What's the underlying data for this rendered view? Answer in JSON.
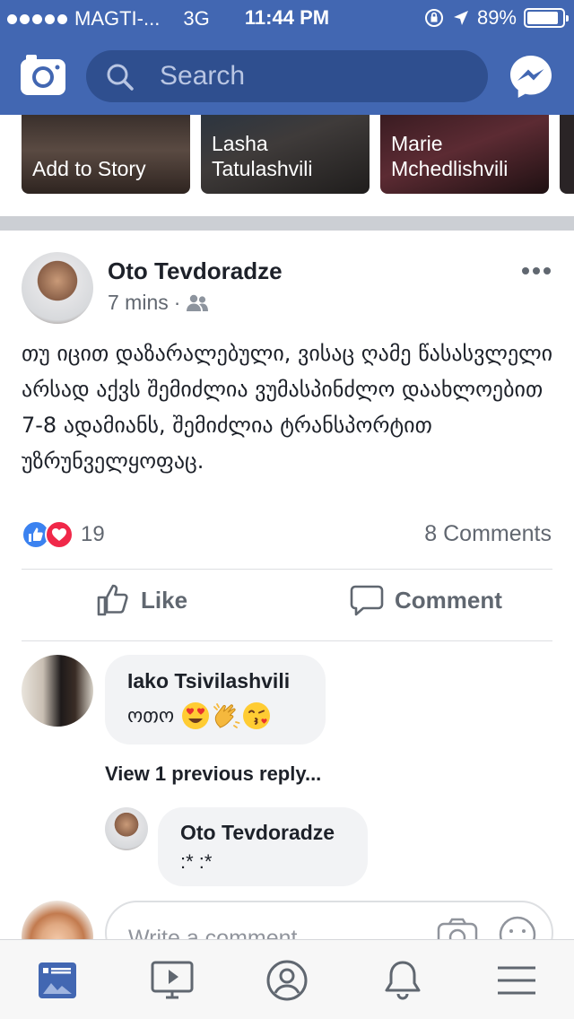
{
  "status_bar": {
    "carrier": "MAGTI-...",
    "network": "3G",
    "time": "11:44 PM",
    "battery": "89%",
    "battery_level": 0.89
  },
  "header": {
    "search_placeholder": "Search",
    "icons": [
      "camera-icon",
      "search-icon",
      "messenger-icon"
    ]
  },
  "stories": [
    {
      "label": "Add to Story"
    },
    {
      "label": "Lasha Tatulashvili"
    },
    {
      "label": "Marie Mchedlishvili"
    }
  ],
  "post": {
    "author": "Oto Tevdoradze",
    "time": "7 mins",
    "separator": "·",
    "audience_icon": "friends-icon",
    "text": "თუ იცით დაზარალებული, ვისაც ღამე წასასვლელი არსად აქვს შემიძლია ვუმასპინძლო დაახლოებით 7-8 ადამიანს, შემიძლია ტრანსპორტით უზრუნველყოფაც.",
    "reactions_count": "19",
    "reaction_types": [
      "like",
      "love"
    ],
    "comments_count": "8 Comments",
    "actions": {
      "like": "Like",
      "comment": "Comment"
    }
  },
  "comments": [
    {
      "author": "Iako Tsivilashvili",
      "text": "ოთო",
      "emojis": [
        "heart-eyes",
        "clapping-hands",
        "kissing-face"
      ]
    }
  ],
  "view_previous": "View 1 previous reply...",
  "replies": [
    {
      "author": "Oto Tevdoradze",
      "text": ":* :*"
    }
  ],
  "composer": {
    "placeholder": "Write a comment..."
  },
  "tabs": [
    {
      "name": "news-feed",
      "active": true
    },
    {
      "name": "watch",
      "active": false
    },
    {
      "name": "profile",
      "active": false
    },
    {
      "name": "notifications",
      "active": false
    },
    {
      "name": "menu",
      "active": false
    }
  ],
  "colors": {
    "brand": "#4267b2",
    "like": "#3b82f0",
    "love": "#f02849",
    "active_tab": "#4267b2"
  }
}
